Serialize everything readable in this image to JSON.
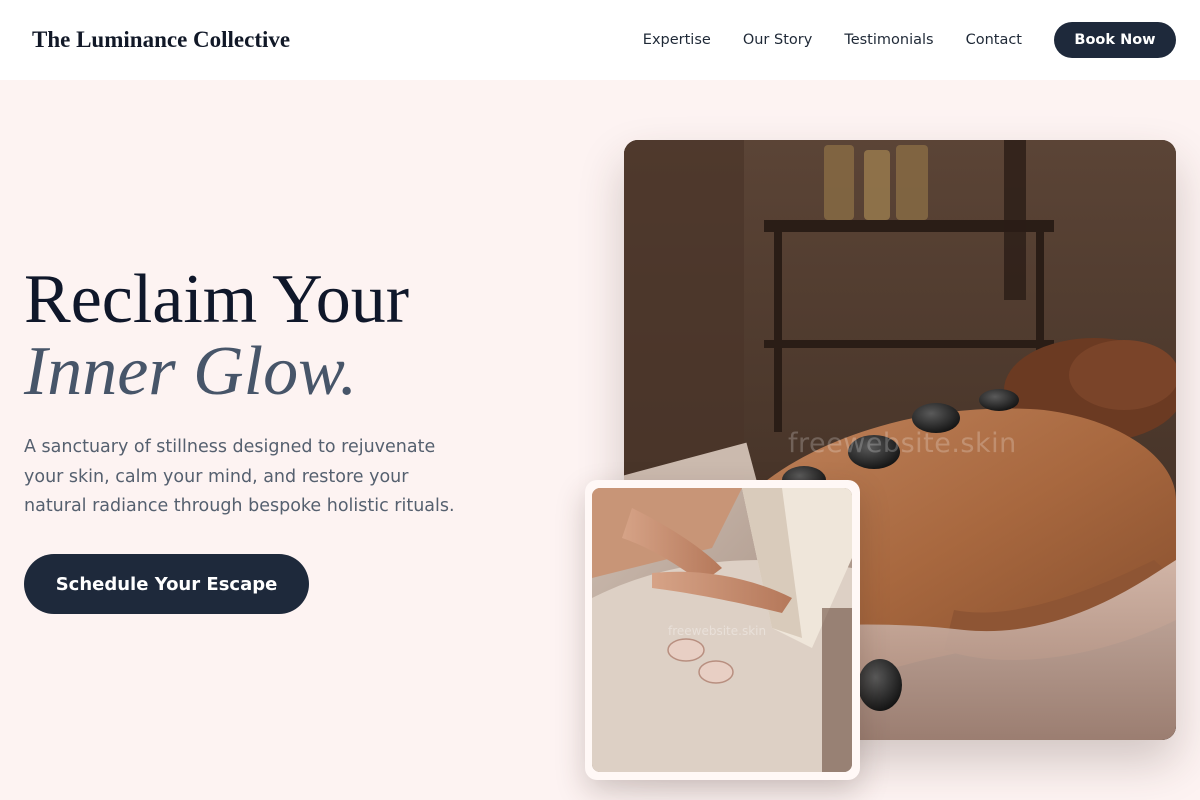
{
  "header": {
    "brand": "The Luminance Collective",
    "nav": [
      {
        "label": "Expertise"
      },
      {
        "label": "Our Story"
      },
      {
        "label": "Testimonials"
      },
      {
        "label": "Contact"
      }
    ],
    "book_label": "Book Now"
  },
  "hero": {
    "title_line1": "Reclaim Your",
    "title_line2": "Inner Glow.",
    "description": "A sanctuary of stillness designed to rejuvenate your skin, calm your mind, and restore your natural radiance through bespoke holistic rituals.",
    "cta_label": "Schedule Your Escape"
  },
  "images": {
    "main_alt": "Hot stone massage treatment",
    "inset_alt": "Massage therapist hands with oil drops",
    "watermark": "freewebsite.skin",
    "watermark_small": "freewebsite.skin"
  },
  "colors": {
    "background": "#fdf3f2",
    "header_bg": "#ffffff",
    "primary": "#1e293b",
    "accent_italic": "#475569"
  }
}
